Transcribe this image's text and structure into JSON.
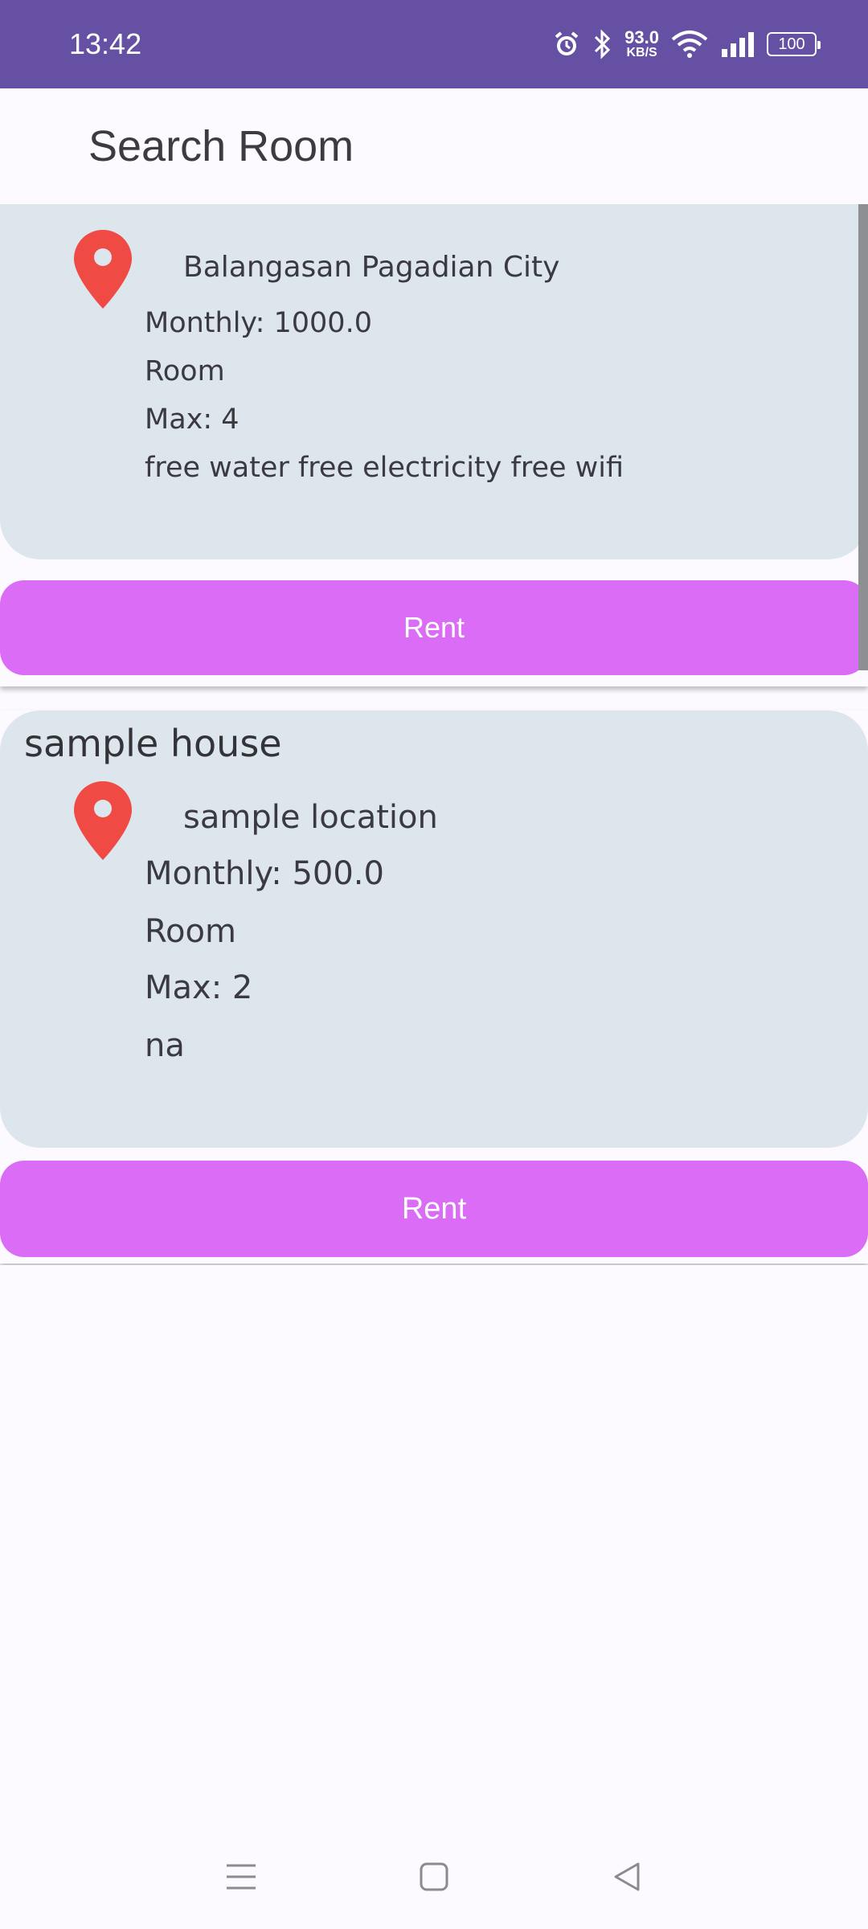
{
  "status_bar": {
    "time": "13:42",
    "speed_value": "93.0",
    "speed_unit": "KB/S",
    "battery": "100"
  },
  "app_bar": {
    "title": "Search Room"
  },
  "listings": [
    {
      "location": "Balangasan Pagadian City",
      "monthly": "Monthly: 1000.0",
      "type": "Room",
      "max": "Max: 4",
      "description": "free water free electricity free wifi",
      "rent_label": "Rent"
    },
    {
      "title": "sample house",
      "location": "sample location",
      "monthly": "Monthly: 500.0",
      "type": "Room",
      "max": "Max: 2",
      "description": "na",
      "rent_label": "Rent"
    }
  ],
  "colors": {
    "status_bar": "#6650a4",
    "card_bg": "#dde5ed",
    "rent_button": "#db6cf6",
    "pin": "#f04a45"
  },
  "icons": {
    "location": "location-pin-icon",
    "alarm": "alarm-icon",
    "bluetooth": "bluetooth-icon",
    "wifi": "wifi-icon",
    "signal": "signal-icon",
    "menu": "menu-icon",
    "home": "home-square-icon",
    "back": "back-triangle-icon"
  }
}
